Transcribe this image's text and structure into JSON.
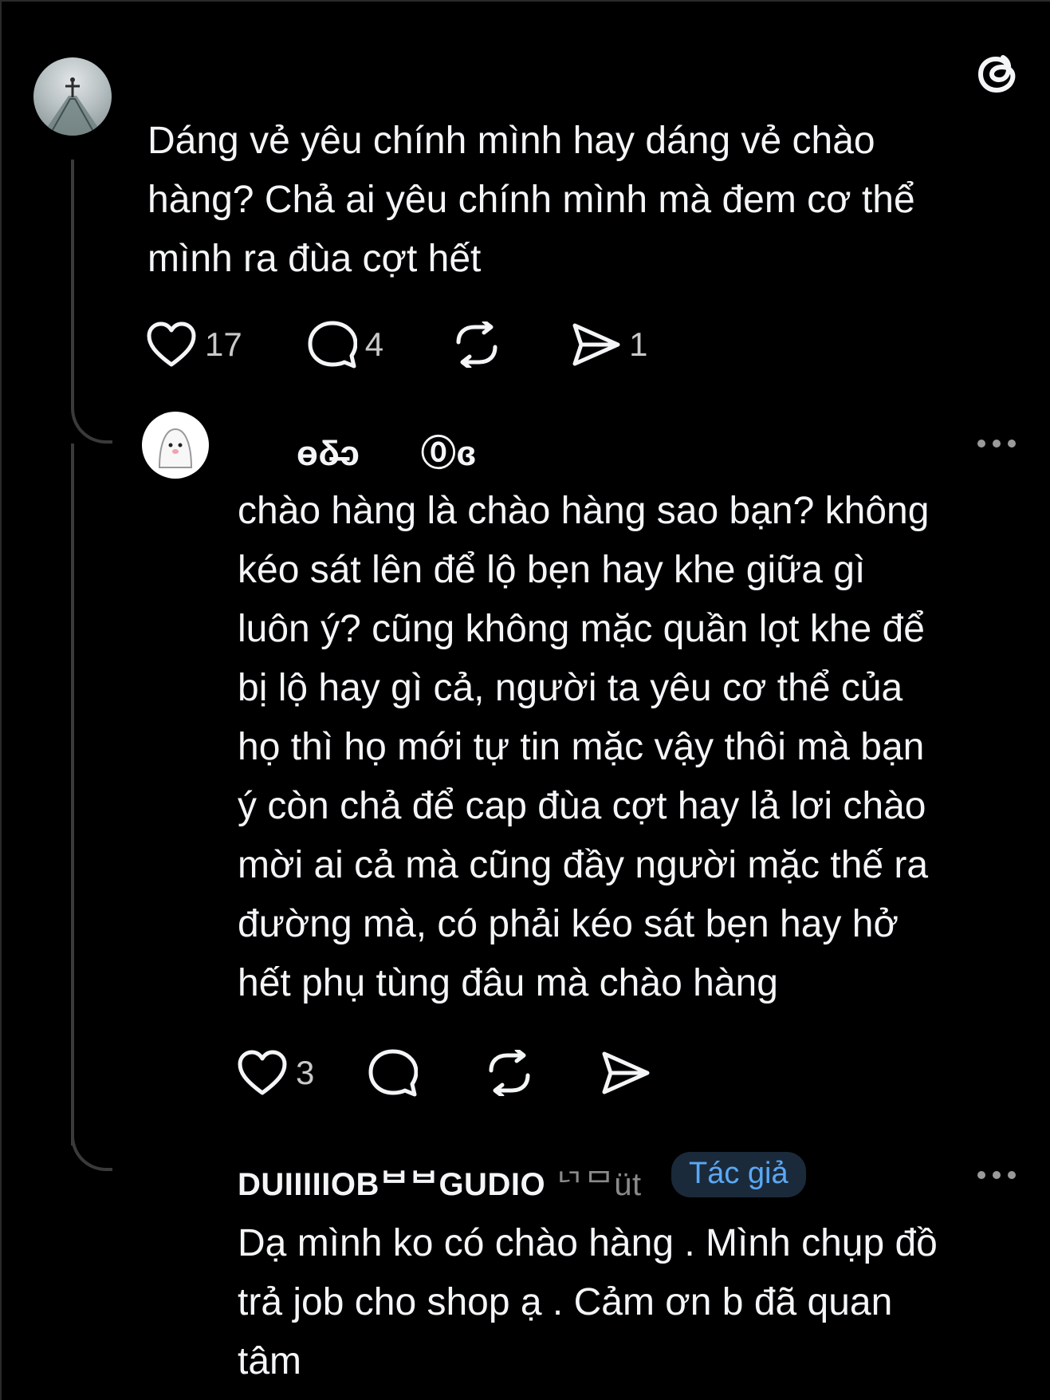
{
  "app": {
    "logo_icon": "threads-logo-icon",
    "background": "#000000",
    "accent": "#5aa8f5"
  },
  "post": {
    "text": "Dáng vẻ yêu chính mình hay dáng vẻ chào\nhàng? Chả ai yêu chính mình mà đem cơ thể\nmình ra đùa cợt hết",
    "likes": "17",
    "comments": "4",
    "shares": "1"
  },
  "reply1": {
    "username_glyphs": "ɵδ̶̶ↄ      ⓪ɞ",
    "text": "chào hàng là chào hàng sao bạn? không\nkéo sát lên để lộ bẹn hay khe giữa gì\nluôn ý? cũng không mặc quần lọt khe để\nbị lộ hay gì cả, người ta yêu cơ thể của\nhọ thì họ mới tự tin mặc vậy thôi mà bạn\ný còn chả để cap đùa cợt hay lả lơi chào\nmời ai cả mà cũng đầy người mặc thế ra\nđường mà, có phải kéo sát bẹn hay hở\nhết phụ tùng đâu mà chào hàng",
    "likes": "3"
  },
  "reply2": {
    "username": "DUIIIIIOBᄇᄇGUDIO",
    "timestamp": "ᄓᄆüt",
    "badge": "Tác giả",
    "text": "Dạ mình ko có chào hàng . Mình chụp đồ\ntrả job cho shop ạ . Cảm ơn b đã quan\ntâm"
  }
}
